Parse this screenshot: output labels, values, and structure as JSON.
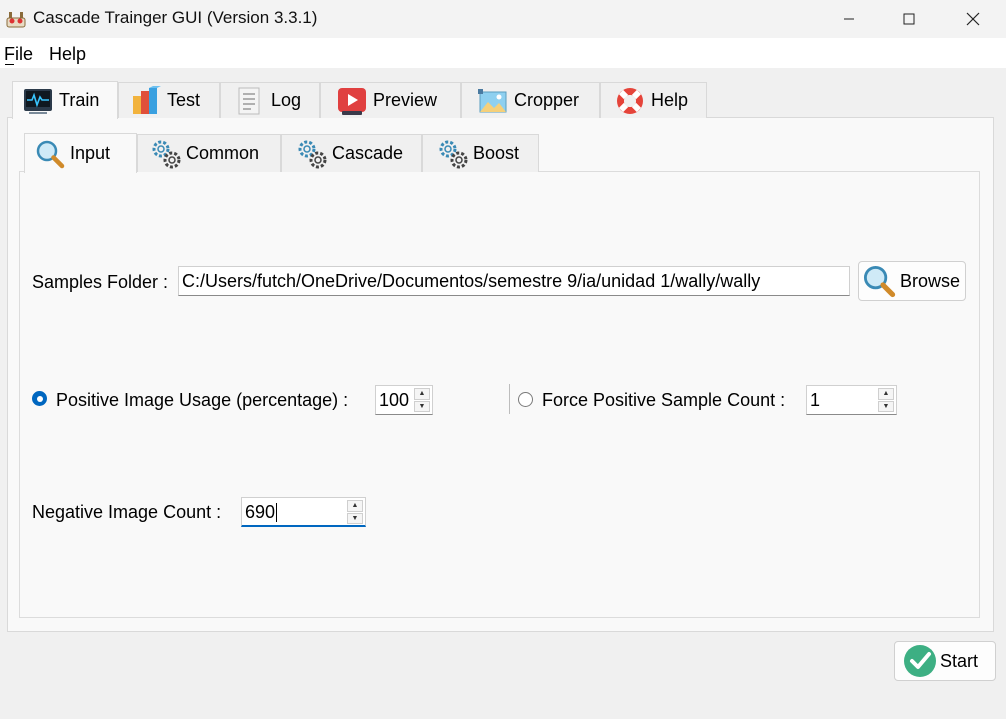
{
  "window": {
    "title": "Cascade Trainger GUI (Version 3.3.1)"
  },
  "menu": {
    "file": "File",
    "help": "Help"
  },
  "tabs": [
    {
      "label": "Train",
      "icon": "heart-monitor-icon"
    },
    {
      "label": "Test",
      "icon": "blocks-icon"
    },
    {
      "label": "Log",
      "icon": "document-icon"
    },
    {
      "label": "Preview",
      "icon": "video-player-icon"
    },
    {
      "label": "Cropper",
      "icon": "image-crop-icon"
    },
    {
      "label": "Help",
      "icon": "lifebuoy-icon"
    }
  ],
  "subtabs": [
    {
      "label": "Input",
      "icon": "magnifier-icon"
    },
    {
      "label": "Common",
      "icon": "gears-icon"
    },
    {
      "label": "Cascade",
      "icon": "gears-icon"
    },
    {
      "label": "Boost",
      "icon": "gears-icon"
    }
  ],
  "input": {
    "samples_folder_label": "Samples Folder :",
    "samples_folder_value": "C:/Users/futch/OneDrive/Documentos/semestre 9/ia/unidad 1/wally/wally",
    "browse_label": "Browse",
    "positive_usage_label": "Positive Image Usage (percentage) :",
    "positive_usage_value": "100",
    "force_positive_label": "Force Positive Sample Count :",
    "force_positive_value": "1",
    "negative_count_label": "Negative Image Count :",
    "negative_count_value": "690"
  },
  "actions": {
    "start_label": "Start"
  },
  "colors": {
    "accent": "#0067c0",
    "start_check": "#3daf83"
  }
}
